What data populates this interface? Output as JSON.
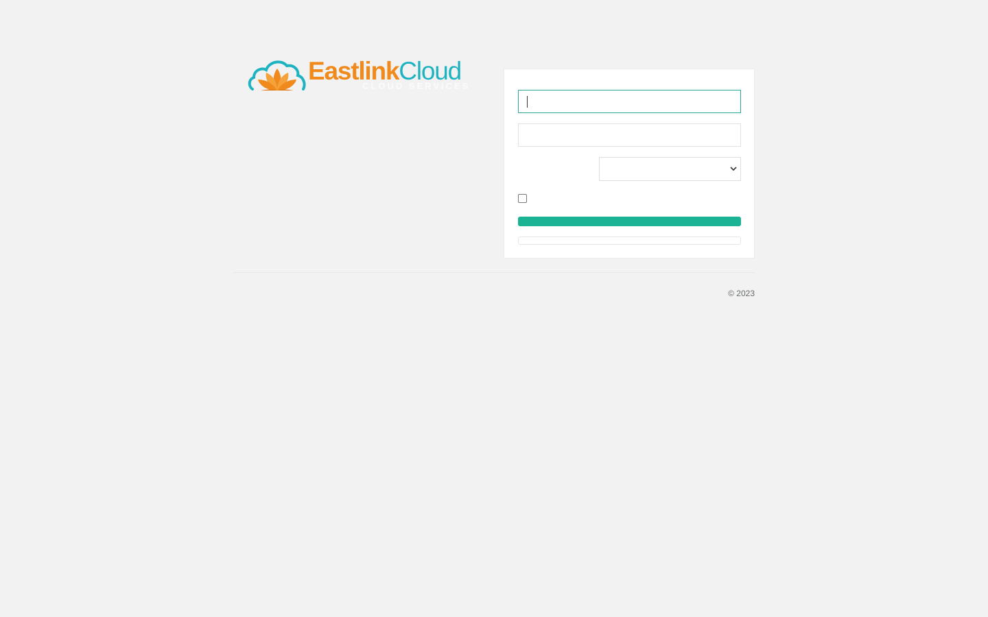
{
  "brand": {
    "name_part1": "Eastlink",
    "name_part2": "Cloud",
    "tagline": "CLOUD SERVICES",
    "primary_color": "#f08a1c",
    "secondary_color": "#1fb3c1",
    "logo_icon": "cloud-lotus-icon"
  },
  "login": {
    "username_value": "",
    "password_value": "",
    "select_value": "",
    "remember_checked": false,
    "submit_label": "",
    "secondary_label": "",
    "accent_color": "#1ab394",
    "focus_color": "#2aa59a"
  },
  "footer": {
    "copyright": "© 2023"
  }
}
